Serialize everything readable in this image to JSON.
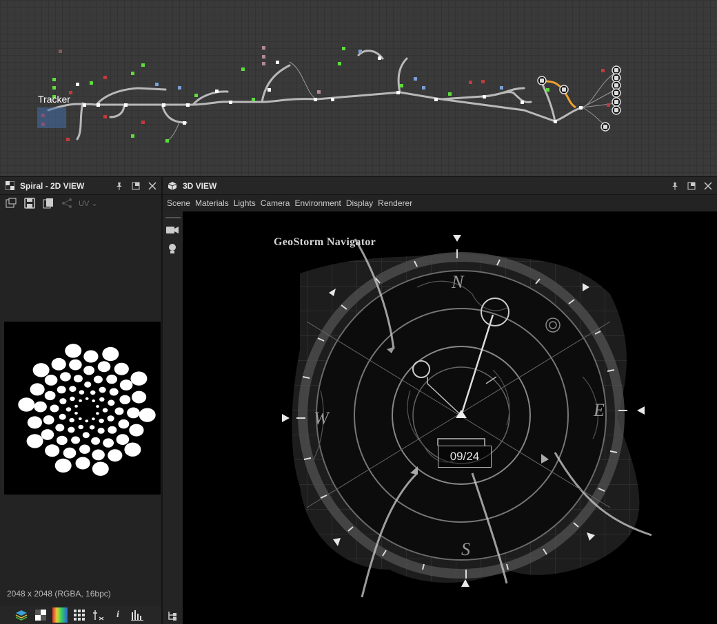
{
  "graph": {
    "tracker_label": "Tracker"
  },
  "left_panel": {
    "title": "Spiral - 2D VIEW",
    "uv_label": "UV",
    "resolution": "2048 x 2048 (RGBA, 16bpc)",
    "icons": [
      "pin-icon",
      "maximize-icon",
      "close-icon"
    ]
  },
  "right_panel": {
    "title": "3D VIEW",
    "menu": [
      "Scene",
      "Materials",
      "Lights",
      "Camera",
      "Environment",
      "Display",
      "Renderer"
    ]
  },
  "viewport": {
    "title": "GeoStorm Navigator",
    "date": "09/24",
    "compass": {
      "north": "N",
      "south": "S",
      "east": "E",
      "west": "W"
    }
  },
  "colors": {
    "graph_bg": "#3a3a3a",
    "panel_bg": "#232323",
    "node_green": "#5ddc3a",
    "node_red": "#c23a3a",
    "node_highlight": "#f0a030"
  }
}
